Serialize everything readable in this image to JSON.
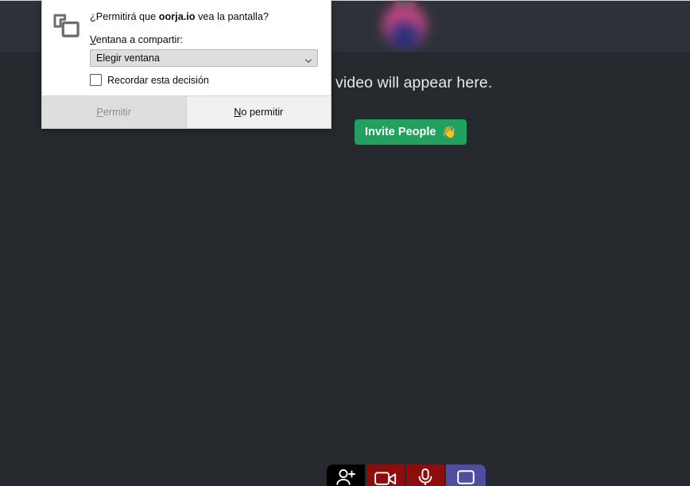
{
  "app": {
    "empty_state_message": "As people join their video will appear here.",
    "invite_button_label": "Invite People",
    "invite_button_emoji": "👋",
    "avatar_name": "self-video-avatar",
    "colors": {
      "top_bar": "#2e3238",
      "stage": "#26292d",
      "invite_green": "#22a05f",
      "mute_red": "#8f0c0c",
      "share_purple": "#4f4d9e",
      "add_black": "#000000"
    },
    "controls": [
      {
        "name": "add-person",
        "label": "Add person",
        "color": "#000000"
      },
      {
        "name": "camera-toggle",
        "label": "Camera off",
        "color": "#8f0c0c"
      },
      {
        "name": "microphone-toggle",
        "label": "Microphone off",
        "color": "#8f0c0c"
      },
      {
        "name": "screen-share-toggle",
        "label": "Share screen",
        "color": "#4f4d9e"
      }
    ]
  },
  "dialog": {
    "icon": "screen-share-icon",
    "question_prefix": "¿Permitirá que ",
    "origin": "oorja.io",
    "question_suffix": " vea la pantalla?",
    "select_label_accesskey": "V",
    "select_label_rest": "entana a compartir:",
    "select_value": "Elegir ventana",
    "select_options": [
      "Elegir ventana"
    ],
    "remember_label": "Recordar esta decisión",
    "remember_checked": false,
    "allow_accesskey": "P",
    "allow_rest": "ermitir",
    "allow_disabled": true,
    "deny_accesskey": "N",
    "deny_rest": "o permitir"
  }
}
